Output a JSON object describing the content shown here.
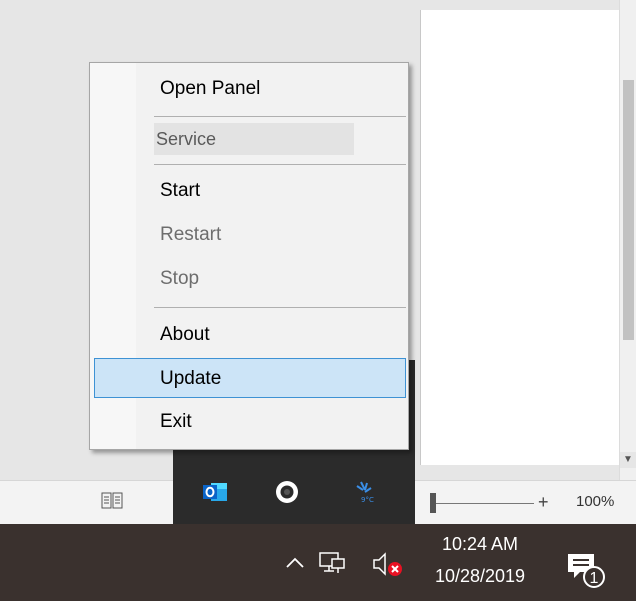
{
  "context_menu": {
    "open_panel": "Open Panel",
    "section_header": "Service",
    "start": "Start",
    "restart": "Restart",
    "stop": "Stop",
    "about": "About",
    "update": "Update",
    "exit": "Exit"
  },
  "status_bar": {
    "zoom_plus": "+",
    "zoom_level": "100%"
  },
  "taskbar": {
    "time": "10:24 AM",
    "date": "10/28/2019",
    "notification_count": "1"
  },
  "colors": {
    "menu_highlight": "#cce4f7",
    "menu_highlight_border": "#3e92d4",
    "taskbar": "#3a312e",
    "outlook_blue": "#0a64c8"
  }
}
